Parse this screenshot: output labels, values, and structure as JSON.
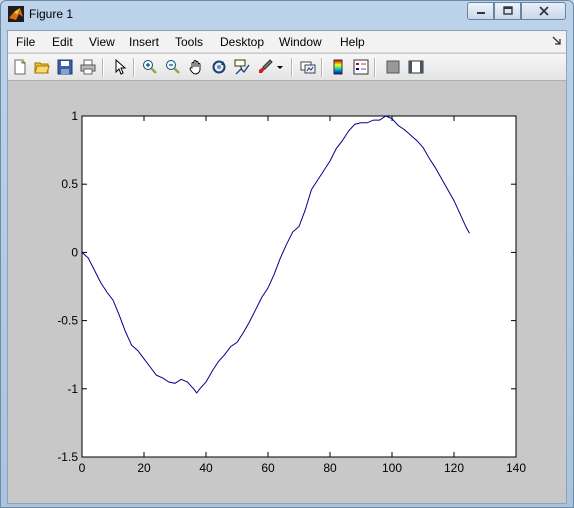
{
  "window": {
    "title": "Figure 1"
  },
  "menu": {
    "items": [
      "File",
      "Edit",
      "View",
      "Insert",
      "Tools",
      "Desktop",
      "Window",
      "Help"
    ]
  },
  "toolbar": {
    "buttons": [
      {
        "name": "new-figure-icon"
      },
      {
        "name": "open-file-icon"
      },
      {
        "name": "save-icon"
      },
      {
        "name": "print-icon"
      },
      {
        "name": "edit-plot-arrow-icon"
      },
      {
        "name": "zoom-in-icon"
      },
      {
        "name": "zoom-out-icon"
      },
      {
        "name": "pan-hand-icon"
      },
      {
        "name": "rotate-3d-icon"
      },
      {
        "name": "data-cursor-icon"
      },
      {
        "name": "brush-icon"
      },
      {
        "name": "brush-dropdown-icon"
      },
      {
        "name": "link-plot-icon"
      },
      {
        "name": "insert-colorbar-icon"
      },
      {
        "name": "insert-legend-icon"
      },
      {
        "name": "hide-plot-tools-icon"
      },
      {
        "name": "show-plot-tools-icon"
      }
    ]
  },
  "chart_data": {
    "type": "line",
    "title": "",
    "xlabel": "",
    "ylabel": "",
    "xlim": [
      0,
      140
    ],
    "ylim": [
      -1.5,
      1
    ],
    "xticks": [
      0,
      20,
      40,
      60,
      80,
      100,
      120,
      140
    ],
    "xtick_labels": [
      "0",
      "20",
      "40",
      "60",
      "80",
      "100",
      "120",
      "140"
    ],
    "yticks": [
      -1.5,
      -1,
      -0.5,
      0,
      0.5,
      1
    ],
    "ytick_labels": [
      "-1.5",
      "-1",
      "-0.5",
      "0",
      "0.5",
      "1"
    ],
    "grid": false,
    "line_color": "#00008b",
    "series": [
      {
        "x": [
          0,
          2,
          4,
          6,
          8,
          10,
          12,
          14,
          16,
          18,
          20,
          22,
          24,
          26,
          28,
          30,
          32,
          34,
          36,
          37,
          38,
          40,
          42,
          44,
          46,
          48,
          50,
          52,
          54,
          56,
          58,
          60,
          62,
          64,
          66,
          68,
          70,
          72,
          74,
          76,
          78,
          80,
          82,
          84,
          86,
          88,
          90,
          92,
          94,
          96,
          98,
          100,
          102,
          104,
          106,
          108,
          110,
          112,
          114,
          116,
          118,
          120,
          122,
          124,
          125
        ],
        "y": [
          0.0,
          -0.04,
          -0.13,
          -0.22,
          -0.29,
          -0.35,
          -0.46,
          -0.58,
          -0.68,
          -0.72,
          -0.78,
          -0.84,
          -0.9,
          -0.92,
          -0.95,
          -0.96,
          -0.93,
          -0.95,
          -1.0,
          -1.03,
          -1.0,
          -0.95,
          -0.87,
          -0.8,
          -0.75,
          -0.69,
          -0.66,
          -0.59,
          -0.51,
          -0.42,
          -0.33,
          -0.26,
          -0.16,
          -0.04,
          0.06,
          0.15,
          0.19,
          0.31,
          0.46,
          0.53,
          0.6,
          0.67,
          0.76,
          0.82,
          0.89,
          0.94,
          0.95,
          0.95,
          0.97,
          0.97,
          1.0,
          0.98,
          0.93,
          0.9,
          0.86,
          0.82,
          0.77,
          0.69,
          0.62,
          0.54,
          0.46,
          0.38,
          0.28,
          0.18,
          0.14
        ]
      }
    ]
  }
}
